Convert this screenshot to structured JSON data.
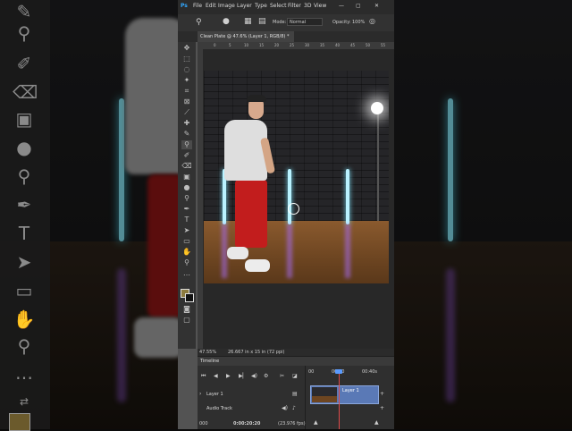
{
  "menu": {
    "logo": "Ps",
    "items": [
      "File",
      "Edit",
      "Image",
      "Layer",
      "Type",
      "Select",
      "Filter",
      "3D",
      "View"
    ]
  },
  "options_bar": {
    "mode_label": "Mode:",
    "mode_value": "Normal",
    "opacity_label": "Opacity:",
    "opacity_value": "100%"
  },
  "document": {
    "tab_title": "Clean Plate @ 47.6% (Layer 1, RGB/8) *",
    "ruler_marks": [
      "0",
      "5",
      "10",
      "15",
      "20",
      "25",
      "30",
      "35",
      "40",
      "45",
      "50",
      "55"
    ]
  },
  "status": {
    "zoom": "47.55%",
    "dimensions": "26.667 in x 15 in (72 ppi)"
  },
  "timeline": {
    "panel_title": "Timeline",
    "ruler_start": "00",
    "ruler_mid": "00:20",
    "ruler_end": "00:40s",
    "layer1_label": "Layer 1",
    "clip_label": "Layer 1",
    "audio_label": "Audio Track",
    "current_time": "0:00:20:20",
    "frame_rate": "(23.976 fps)",
    "frame_counter": "000"
  },
  "colors": {
    "accent_clip": "#5a79b6",
    "playhead": "#e04a4a",
    "foreground": "#8b7a3e"
  }
}
